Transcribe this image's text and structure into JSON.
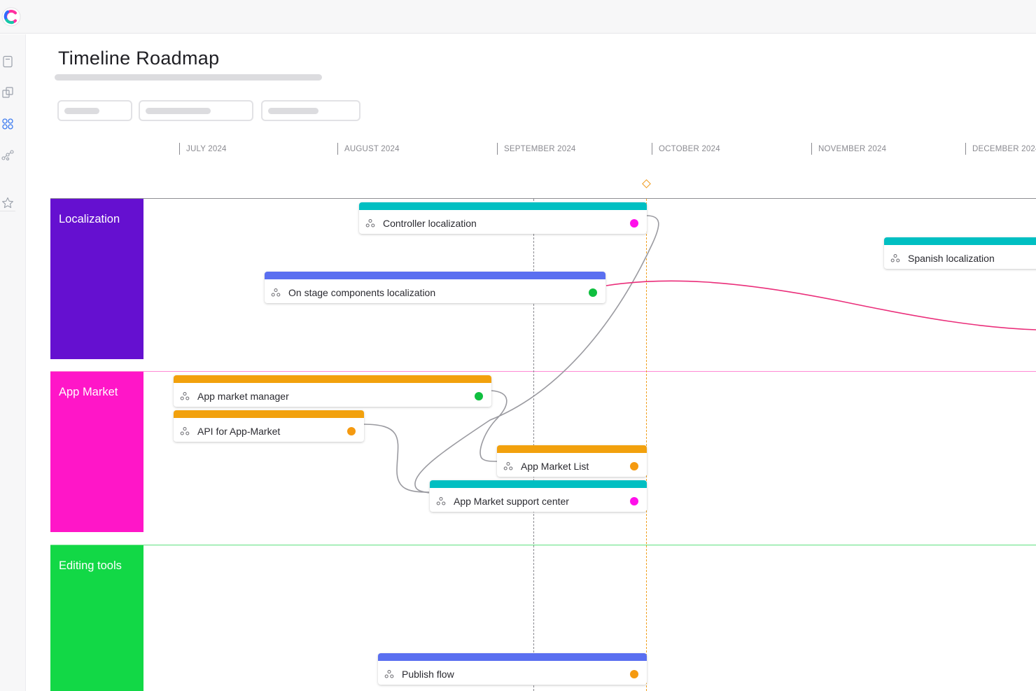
{
  "page": {
    "title": "Timeline Roadmap"
  },
  "colors": {
    "accent_teal": "#00bfc2",
    "accent_blue": "#5a6ff0",
    "accent_orange": "#f2a10d",
    "localization": "#6510d0",
    "app_market": "#ff16c8",
    "editing_tools": "#12d846",
    "status_magenta": "#ff10ea",
    "status_green": "#0fbf3f",
    "status_orange": "#f59a10",
    "link_gray": "#9a9aa0",
    "link_pink": "#ea2e7a",
    "today_marker": "#f0a020"
  },
  "sidebar": {
    "icons": [
      "document-icon",
      "copy-icon",
      "roadmap-icon",
      "graph-icon",
      "star-icon"
    ]
  },
  "timeline": {
    "months": [
      "JULY 2024",
      "AUGUST 2024",
      "SEPTEMBER 2024",
      "OCTOBER 2024",
      "NOVEMBER 2024",
      "DECEMBER 2024"
    ]
  },
  "groups": [
    {
      "label": "Localization",
      "color": "#6510d0"
    },
    {
      "label": "App Market",
      "color": "#ff16c8"
    },
    {
      "label": "Editing tools",
      "color": "#12d846"
    }
  ],
  "items": [
    {
      "label": "Controller localization",
      "bar_color": "#00bfc2",
      "status_color": "#ff10ea"
    },
    {
      "label": "Spanish localization",
      "bar_color": "#00bfc2",
      "status_color": ""
    },
    {
      "label": "On stage components localization",
      "bar_color": "#5a6ff0",
      "status_color": "#0fbf3f"
    },
    {
      "label": "App market manager",
      "bar_color": "#f2a10d",
      "status_color": "#0fbf3f"
    },
    {
      "label": "API for App-Market",
      "bar_color": "#f2a10d",
      "status_color": "#f59a10"
    },
    {
      "label": "App Market List",
      "bar_color": "#f2a10d",
      "status_color": "#f59a10"
    },
    {
      "label": "App Market support center",
      "bar_color": "#00bfc2",
      "status_color": "#ff10ea"
    },
    {
      "label": "Publish flow",
      "bar_color": "#5a6ff0",
      "status_color": "#f59a10"
    }
  ]
}
